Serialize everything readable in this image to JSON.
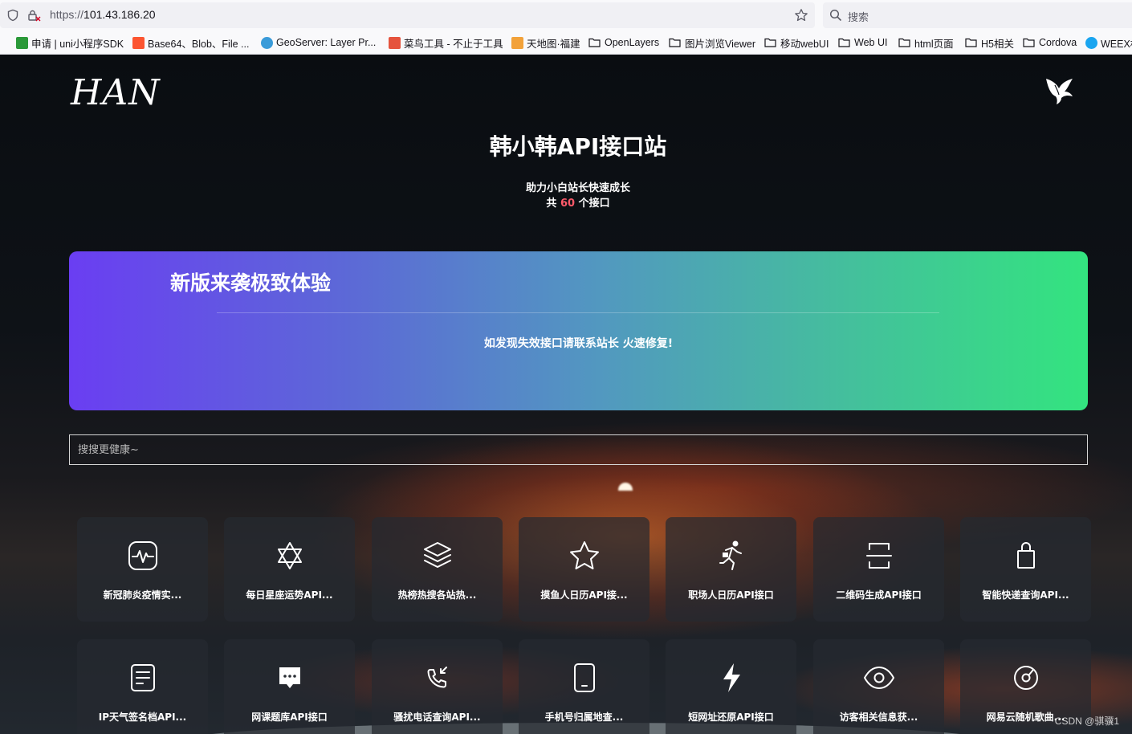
{
  "browser": {
    "url_scheme": "https://",
    "url_host": "101.43.186.20",
    "search_placeholder": "搜索",
    "bookmarks": [
      {
        "label": "申请 | uni小程序SDK",
        "icon": "uni-favicon",
        "color": "#2b9939"
      },
      {
        "label": "Base64、Blob、File ...",
        "icon": "csdn-favicon",
        "color": "#fc5531"
      },
      {
        "label": "GeoServer: Layer Pr...",
        "icon": "geoserver-favicon",
        "color": "#3a9bd9"
      },
      {
        "label": "菜鸟工具 - 不止于工具",
        "icon": "runoob-favicon",
        "color": "#e5533d"
      },
      {
        "label": "天地图·福建",
        "icon": "tianditu-favicon",
        "color": "#f2a23a"
      },
      {
        "label": "OpenLayers",
        "icon": "folder-icon"
      },
      {
        "label": "图片浏览Viewer",
        "icon": "folder-icon"
      },
      {
        "label": "移动webUI",
        "icon": "folder-icon"
      },
      {
        "label": "Web UI",
        "icon": "folder-icon"
      },
      {
        "label": "html页面",
        "icon": "folder-icon"
      },
      {
        "label": "H5相关",
        "icon": "folder-icon"
      },
      {
        "label": "Cordova",
        "icon": "folder-icon"
      },
      {
        "label": "WEEX相",
        "icon": "weex-favicon",
        "color": "#1aa5f0"
      }
    ]
  },
  "site": {
    "logo": "HAN",
    "title": "韩小韩API接口站",
    "subtitle": "助力小白站长快速成长",
    "count_prefix": "共",
    "count": "60",
    "count_suffix": "个接口",
    "accent": "#ff5a6a"
  },
  "banner": {
    "title": "新版来袭极致体验",
    "text": "如发现失效接口请联系站长 火速修复!",
    "gradient_start": "#6a3ef2",
    "gradient_end": "#33e47f"
  },
  "search": {
    "placeholder": "搜搜更健康~"
  },
  "cards": [
    {
      "label": "新冠肺炎疫情实...",
      "icon": "activity-icon"
    },
    {
      "label": "每日星座运势API...",
      "icon": "star-of-david-icon"
    },
    {
      "label": "热榜热搜各站热...",
      "icon": "layers-icon"
    },
    {
      "label": "摸鱼人日历API接...",
      "icon": "star-icon"
    },
    {
      "label": "职场人日历API接口",
      "icon": "running-man-icon"
    },
    {
      "label": "二维码生成API接口",
      "icon": "scan-icon"
    },
    {
      "label": "智能快递查询API...",
      "icon": "bag-icon"
    },
    {
      "label": "IP天气签名档API...",
      "icon": "document-icon"
    },
    {
      "label": "网课题库API接口",
      "icon": "chat-icon"
    },
    {
      "label": "骚扰电话查询API...",
      "icon": "phone-incoming-icon"
    },
    {
      "label": "手机号归属地查...",
      "icon": "mobile-icon"
    },
    {
      "label": "短网址还原API接口",
      "icon": "lightning-icon"
    },
    {
      "label": "访客相关信息获...",
      "icon": "eye-icon"
    },
    {
      "label": "网易云随机歌曲...",
      "icon": "disc-icon"
    }
  ],
  "watermark": "CSDN @骐骥1"
}
